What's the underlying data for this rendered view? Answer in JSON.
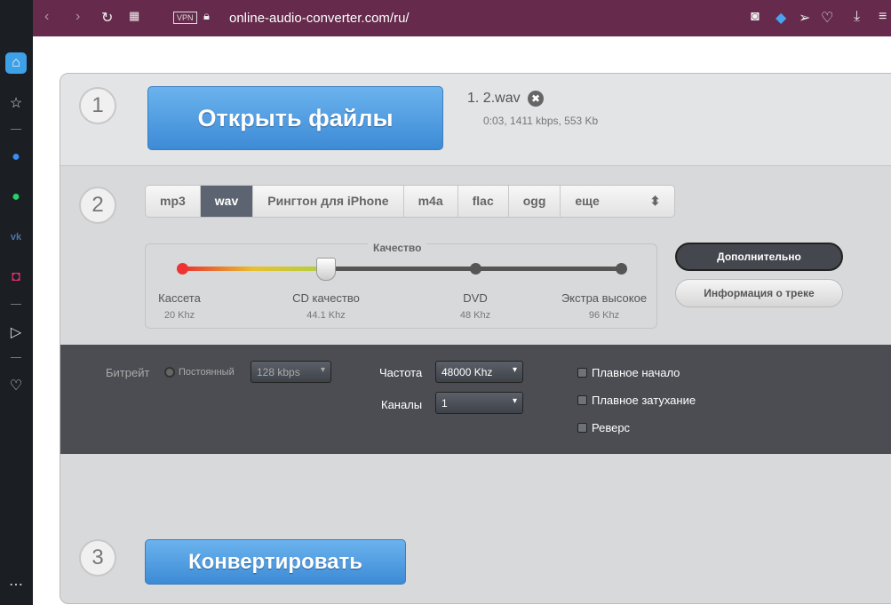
{
  "browser": {
    "url": "online-audio-converter.com/ru/",
    "vpn": "VPN"
  },
  "step1": {
    "num": "1",
    "open_button": "Открыть файлы",
    "file_name": "1. 2.wav",
    "file_info": "0:03, 1411 kbps, 553 Kb"
  },
  "step2": {
    "num": "2",
    "tabs": [
      "mp3",
      "wav",
      "Рингтон для iPhone",
      "m4a",
      "flac",
      "ogg",
      "еще"
    ],
    "quality": {
      "title": "Качество",
      "levels": [
        {
          "label": "Кассета",
          "rate": "20 Khz"
        },
        {
          "label": "CD качество",
          "rate": "44.1 Khz"
        },
        {
          "label": "DVD",
          "rate": "48 Khz"
        },
        {
          "label": "Экстра высокое",
          "rate": "96 Khz"
        }
      ]
    },
    "advanced_button": "Дополнительно",
    "track_info_button": "Информация о треке"
  },
  "advanced": {
    "bitrate_label": "Битрейт",
    "constant_label": "Постоянный",
    "bitrate_value": "128 kbps",
    "freq_label": "Частота",
    "freq_value": "48000 Khz",
    "channels_label": "Каналы",
    "channels_value": "1",
    "fade_in": "Плавное начало",
    "fade_out": "Плавное затухание",
    "reverse": "Реверс"
  },
  "step3": {
    "num": "3",
    "convert_button": "Конвертировать"
  }
}
